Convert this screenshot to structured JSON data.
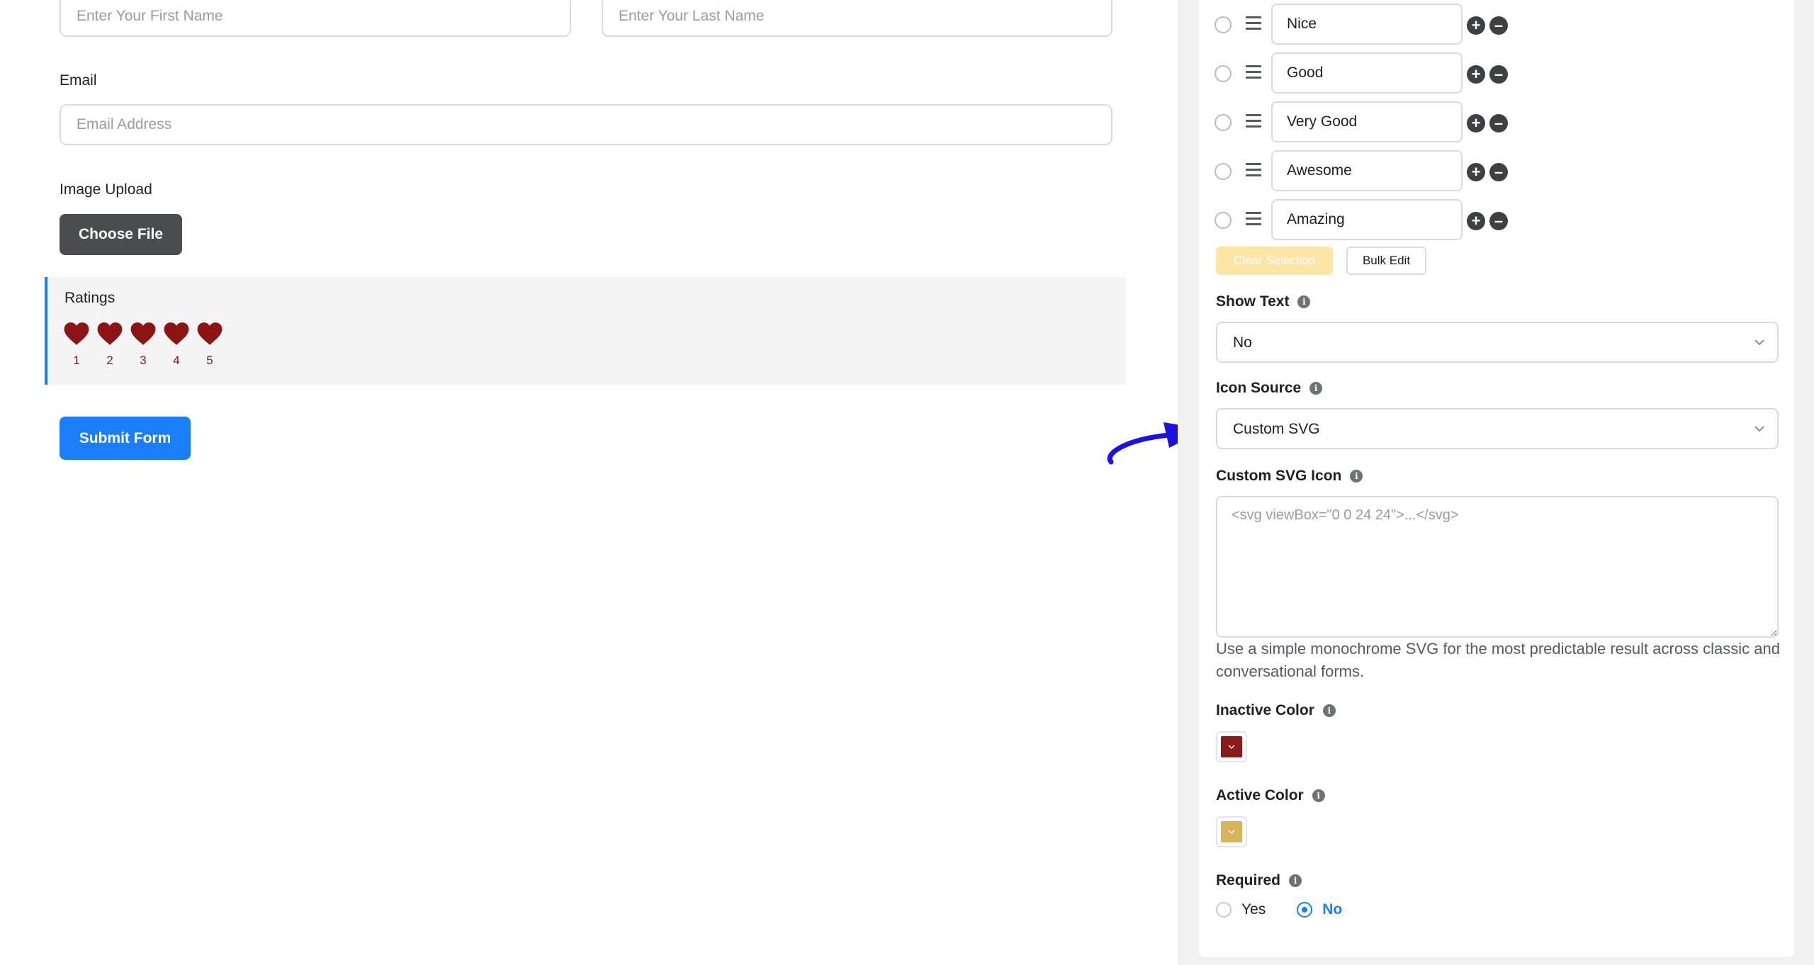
{
  "form": {
    "first_name_placeholder": "Enter Your First Name",
    "last_name_placeholder": "Enter Your Last Name",
    "email_label": "Email",
    "email_placeholder": "Email Address",
    "image_upload_label": "Image Upload",
    "choose_file_label": "Choose File",
    "ratings_label": "Ratings",
    "ratings": [
      "1",
      "2",
      "3",
      "4",
      "5"
    ],
    "heart_color": "#8b1414",
    "submit_label": "Submit Form"
  },
  "settings": {
    "options": [
      {
        "label": "Nice"
      },
      {
        "label": "Good"
      },
      {
        "label": "Very Good"
      },
      {
        "label": "Awesome"
      },
      {
        "label": "Amazing"
      }
    ],
    "clear_selection_label": "Clear Selection",
    "bulk_edit_label": "Bulk Edit",
    "show_text_label": "Show Text",
    "show_text_value": "No",
    "icon_source_label": "Icon Source",
    "icon_source_value": "Custom SVG",
    "custom_svg_label": "Custom SVG Icon",
    "custom_svg_placeholder": "<svg viewBox=\"0 0 24 24\">...</svg>",
    "custom_svg_help": "Use a simple monochrome SVG for the most predictable result across classic and conversational forms.",
    "inactive_color_label": "Inactive Color",
    "inactive_color": "#8b1a1a",
    "active_color_label": "Active Color",
    "active_color": "#d8b45a",
    "required_label": "Required",
    "required_options": [
      "Yes",
      "No"
    ],
    "required_selected": "No"
  },
  "colors": {
    "accent": "#1a7efb",
    "annotation_arrow": "#1c12e0"
  }
}
